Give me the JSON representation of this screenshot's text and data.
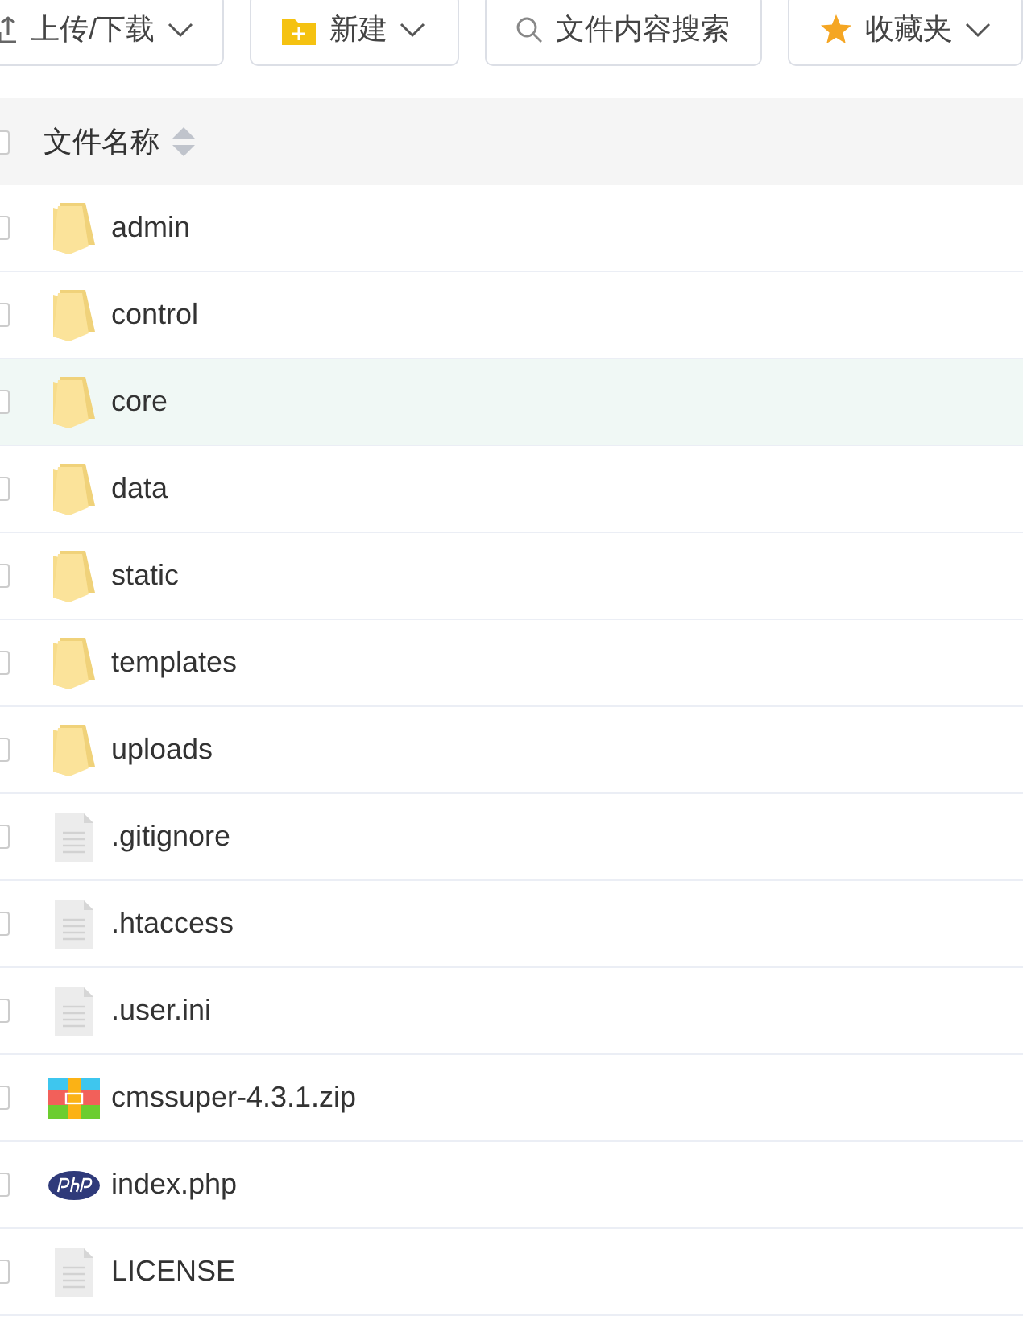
{
  "toolbar": [
    {
      "label": "上传/下载",
      "kind": "upload",
      "dropdown": true
    },
    {
      "label": "新建",
      "kind": "new",
      "dropdown": true
    },
    {
      "label": "文件内容搜索",
      "kind": "search",
      "dropdown": false
    },
    {
      "label": "收藏夹",
      "kind": "favorite",
      "dropdown": true
    }
  ],
  "table": {
    "select_all_checked": false,
    "columns": [
      {
        "label": "文件名称",
        "sortable": true
      }
    ],
    "rows": [
      {
        "name": "admin",
        "kind": "folder",
        "hovered": false,
        "checked": false
      },
      {
        "name": "control",
        "kind": "folder",
        "hovered": false,
        "checked": false
      },
      {
        "name": "core",
        "kind": "folder",
        "hovered": true,
        "checked": false
      },
      {
        "name": "data",
        "kind": "folder",
        "hovered": false,
        "checked": false
      },
      {
        "name": "static",
        "kind": "folder",
        "hovered": false,
        "checked": false
      },
      {
        "name": "templates",
        "kind": "folder",
        "hovered": false,
        "checked": false
      },
      {
        "name": "uploads",
        "kind": "folder",
        "hovered": false,
        "checked": false
      },
      {
        "name": ".gitignore",
        "kind": "file",
        "hovered": false,
        "checked": false
      },
      {
        "name": ".htaccess",
        "kind": "file",
        "hovered": false,
        "checked": false
      },
      {
        "name": ".user.ini",
        "kind": "file",
        "hovered": false,
        "checked": false
      },
      {
        "name": "cmssuper-4.3.1.zip",
        "kind": "zip",
        "hovered": false,
        "checked": false
      },
      {
        "name": "index.php",
        "kind": "php",
        "hovered": false,
        "checked": false
      },
      {
        "name": "LICENSE",
        "kind": "file",
        "hovered": false,
        "checked": false
      }
    ]
  }
}
